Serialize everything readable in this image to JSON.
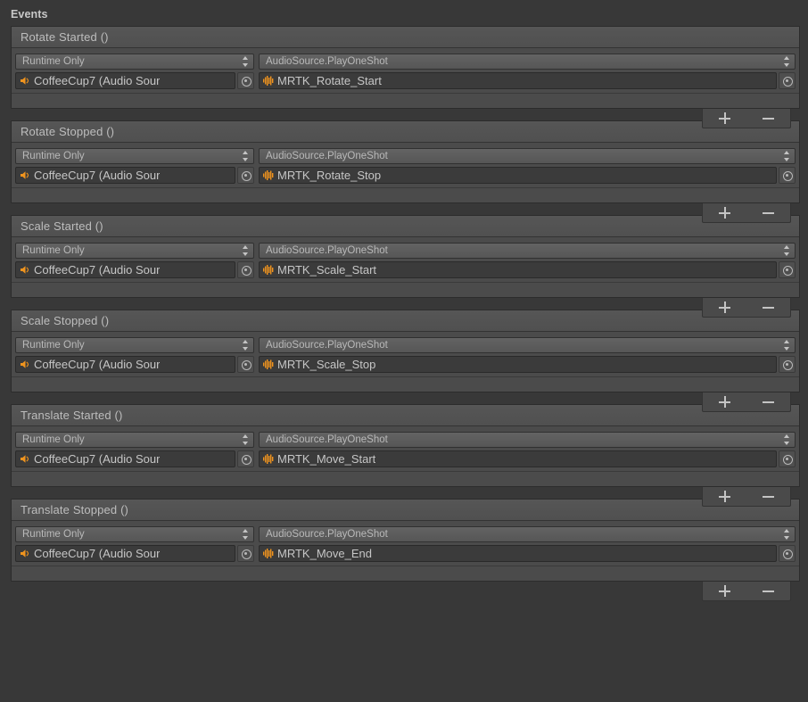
{
  "section": {
    "title": "Events"
  },
  "controls": {
    "add_label": "+",
    "remove_label": "−",
    "add_icon": "plus-icon",
    "remove_icon": "minus-icon",
    "dropdown_icon": "updown-arrow-icon",
    "picker_icon": "object-picker-icon",
    "audiosource_icon": "audio-source-speaker-icon",
    "audioclip_icon": "audio-clip-waveform-icon"
  },
  "colors": {
    "window_background": "#383838",
    "block_background": "#4b4b4b",
    "header_background": "#565656",
    "field_background": "#3b3b3b",
    "text": "#b4b4b4",
    "icon_orange": "#f0941e"
  },
  "events": [
    {
      "title": "Rotate Started ()",
      "listeners": [
        {
          "call_state": "Runtime Only",
          "target_object": "CoffeeCup7 (Audio Sour",
          "function": "AudioSource.PlayOneShot",
          "argument": "MRTK_Rotate_Start"
        }
      ]
    },
    {
      "title": "Rotate Stopped ()",
      "listeners": [
        {
          "call_state": "Runtime Only",
          "target_object": "CoffeeCup7 (Audio Sour",
          "function": "AudioSource.PlayOneShot",
          "argument": "MRTK_Rotate_Stop"
        }
      ]
    },
    {
      "title": "Scale Started ()",
      "listeners": [
        {
          "call_state": "Runtime Only",
          "target_object": "CoffeeCup7 (Audio Sour",
          "function": "AudioSource.PlayOneShot",
          "argument": "MRTK_Scale_Start"
        }
      ]
    },
    {
      "title": "Scale Stopped ()",
      "listeners": [
        {
          "call_state": "Runtime Only",
          "target_object": "CoffeeCup7 (Audio Sour",
          "function": "AudioSource.PlayOneShot",
          "argument": "MRTK_Scale_Stop"
        }
      ]
    },
    {
      "title": "Translate Started ()",
      "listeners": [
        {
          "call_state": "Runtime Only",
          "target_object": "CoffeeCup7 (Audio Sour",
          "function": "AudioSource.PlayOneShot",
          "argument": "MRTK_Move_Start"
        }
      ]
    },
    {
      "title": "Translate Stopped ()",
      "listeners": [
        {
          "call_state": "Runtime Only",
          "target_object": "CoffeeCup7 (Audio Sour",
          "function": "AudioSource.PlayOneShot",
          "argument": "MRTK_Move_End"
        }
      ]
    }
  ]
}
